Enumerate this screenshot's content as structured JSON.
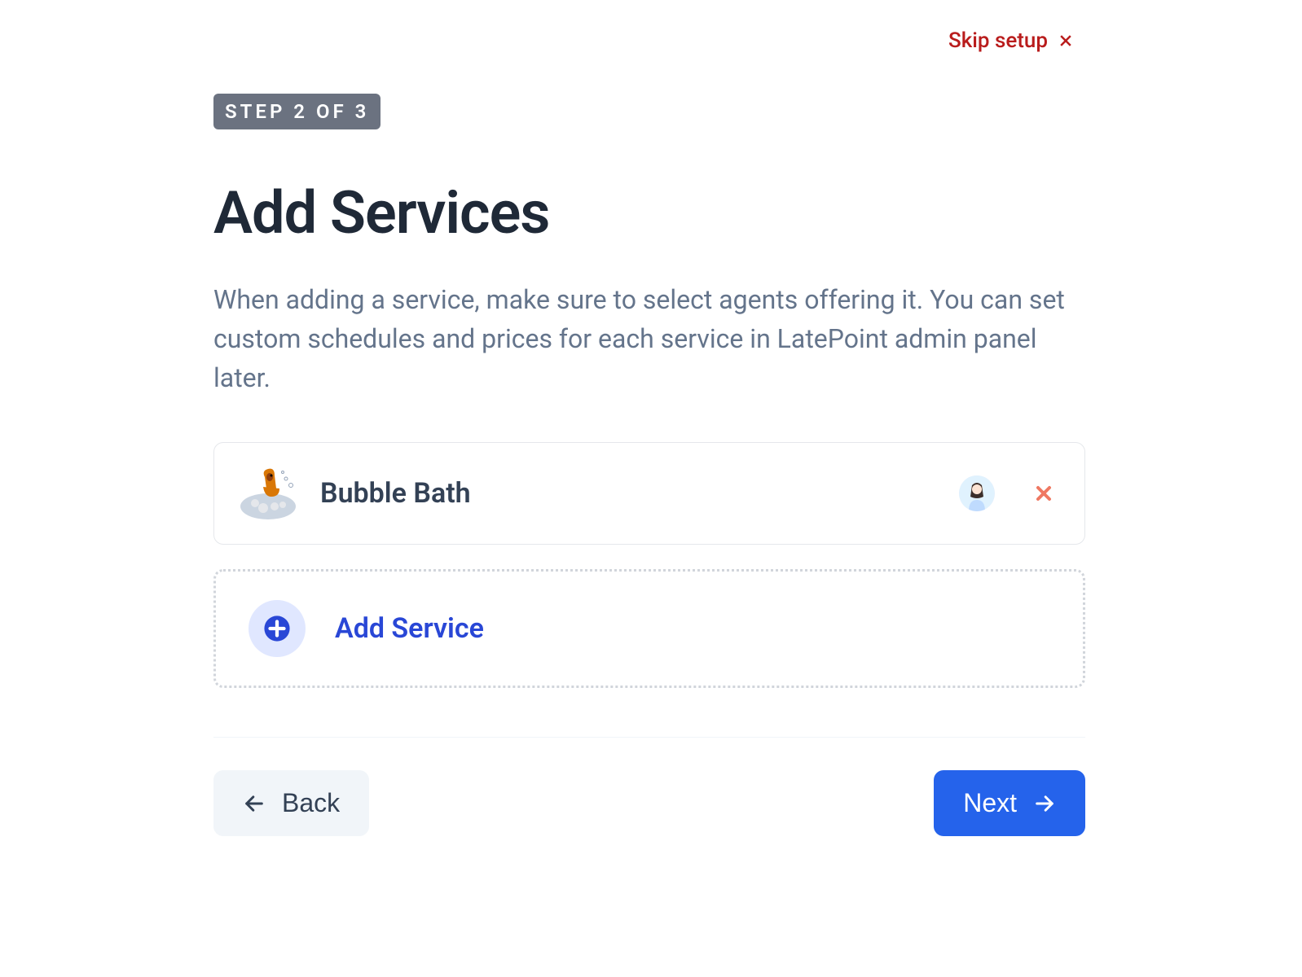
{
  "header": {
    "skip_label": "Skip setup"
  },
  "wizard": {
    "step_badge": "STEP 2 OF 3",
    "title": "Add Services",
    "description": "When adding a service, make sure to select agents offering it. You can set custom schedules and prices for each service in LatePoint admin panel later."
  },
  "services": [
    {
      "name": "Bubble Bath",
      "icon": "dog-bath-icon",
      "agents": [
        {
          "avatar": "agent-avatar"
        }
      ]
    }
  ],
  "actions": {
    "add_service_label": "Add Service",
    "back_label": "Back",
    "next_label": "Next"
  },
  "colors": {
    "primary": "#2563eb",
    "danger": "#b91c1c",
    "text": "#1f2937",
    "muted": "#64748b"
  }
}
